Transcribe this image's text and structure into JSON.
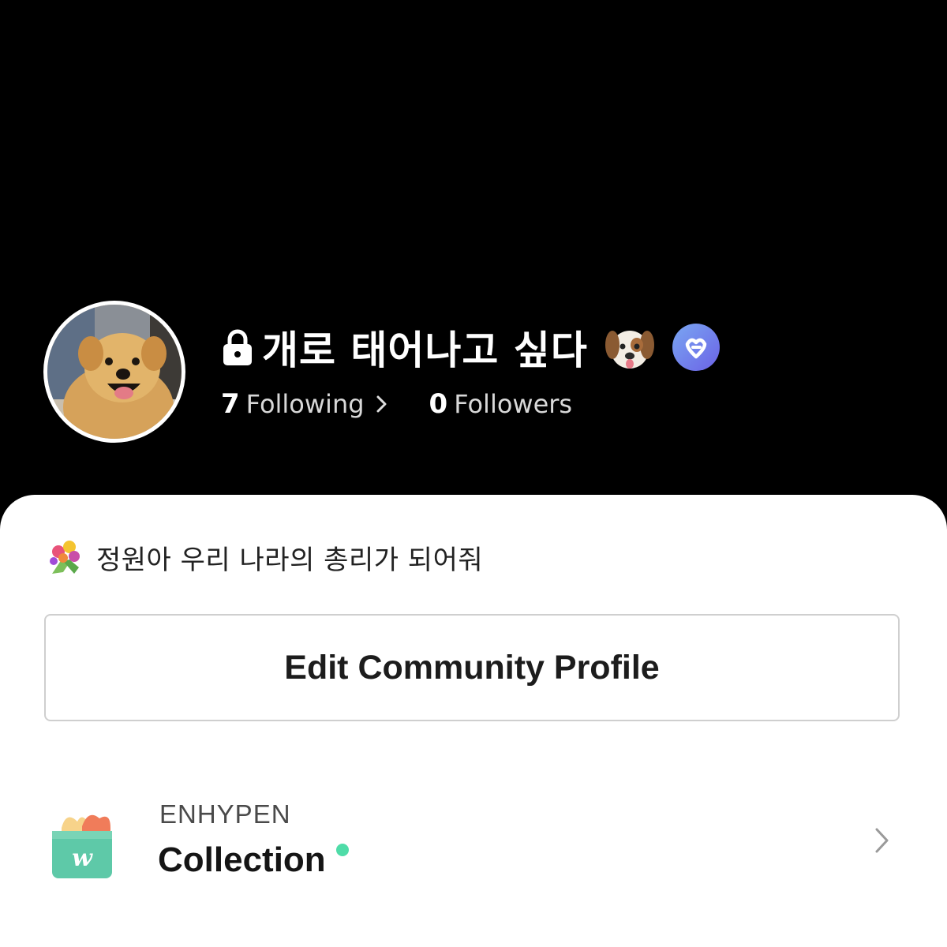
{
  "profile": {
    "nickname": "개로 태어나고 싶다",
    "avatar_icon": "dog-photo-avatar",
    "lock_icon": "lock-icon",
    "emoji_icon": "dog-face-emoji",
    "badge_icon": "weverse-membership-badge",
    "badge_color": "#6f7ef0"
  },
  "stats": {
    "following_count": "7",
    "following_label": "Following",
    "followers_count": "0",
    "followers_label": "Followers"
  },
  "bio": {
    "icon": "bouquet-icon",
    "text": "정원아 우리 나라의 총리가 되어줘"
  },
  "actions": {
    "edit_profile_label": "Edit Community Profile"
  },
  "collection": {
    "artist": "ENHYPEN",
    "label": "Collection",
    "icon": "weverse-shop-icon",
    "new_indicator_color": "#4fdca8"
  }
}
